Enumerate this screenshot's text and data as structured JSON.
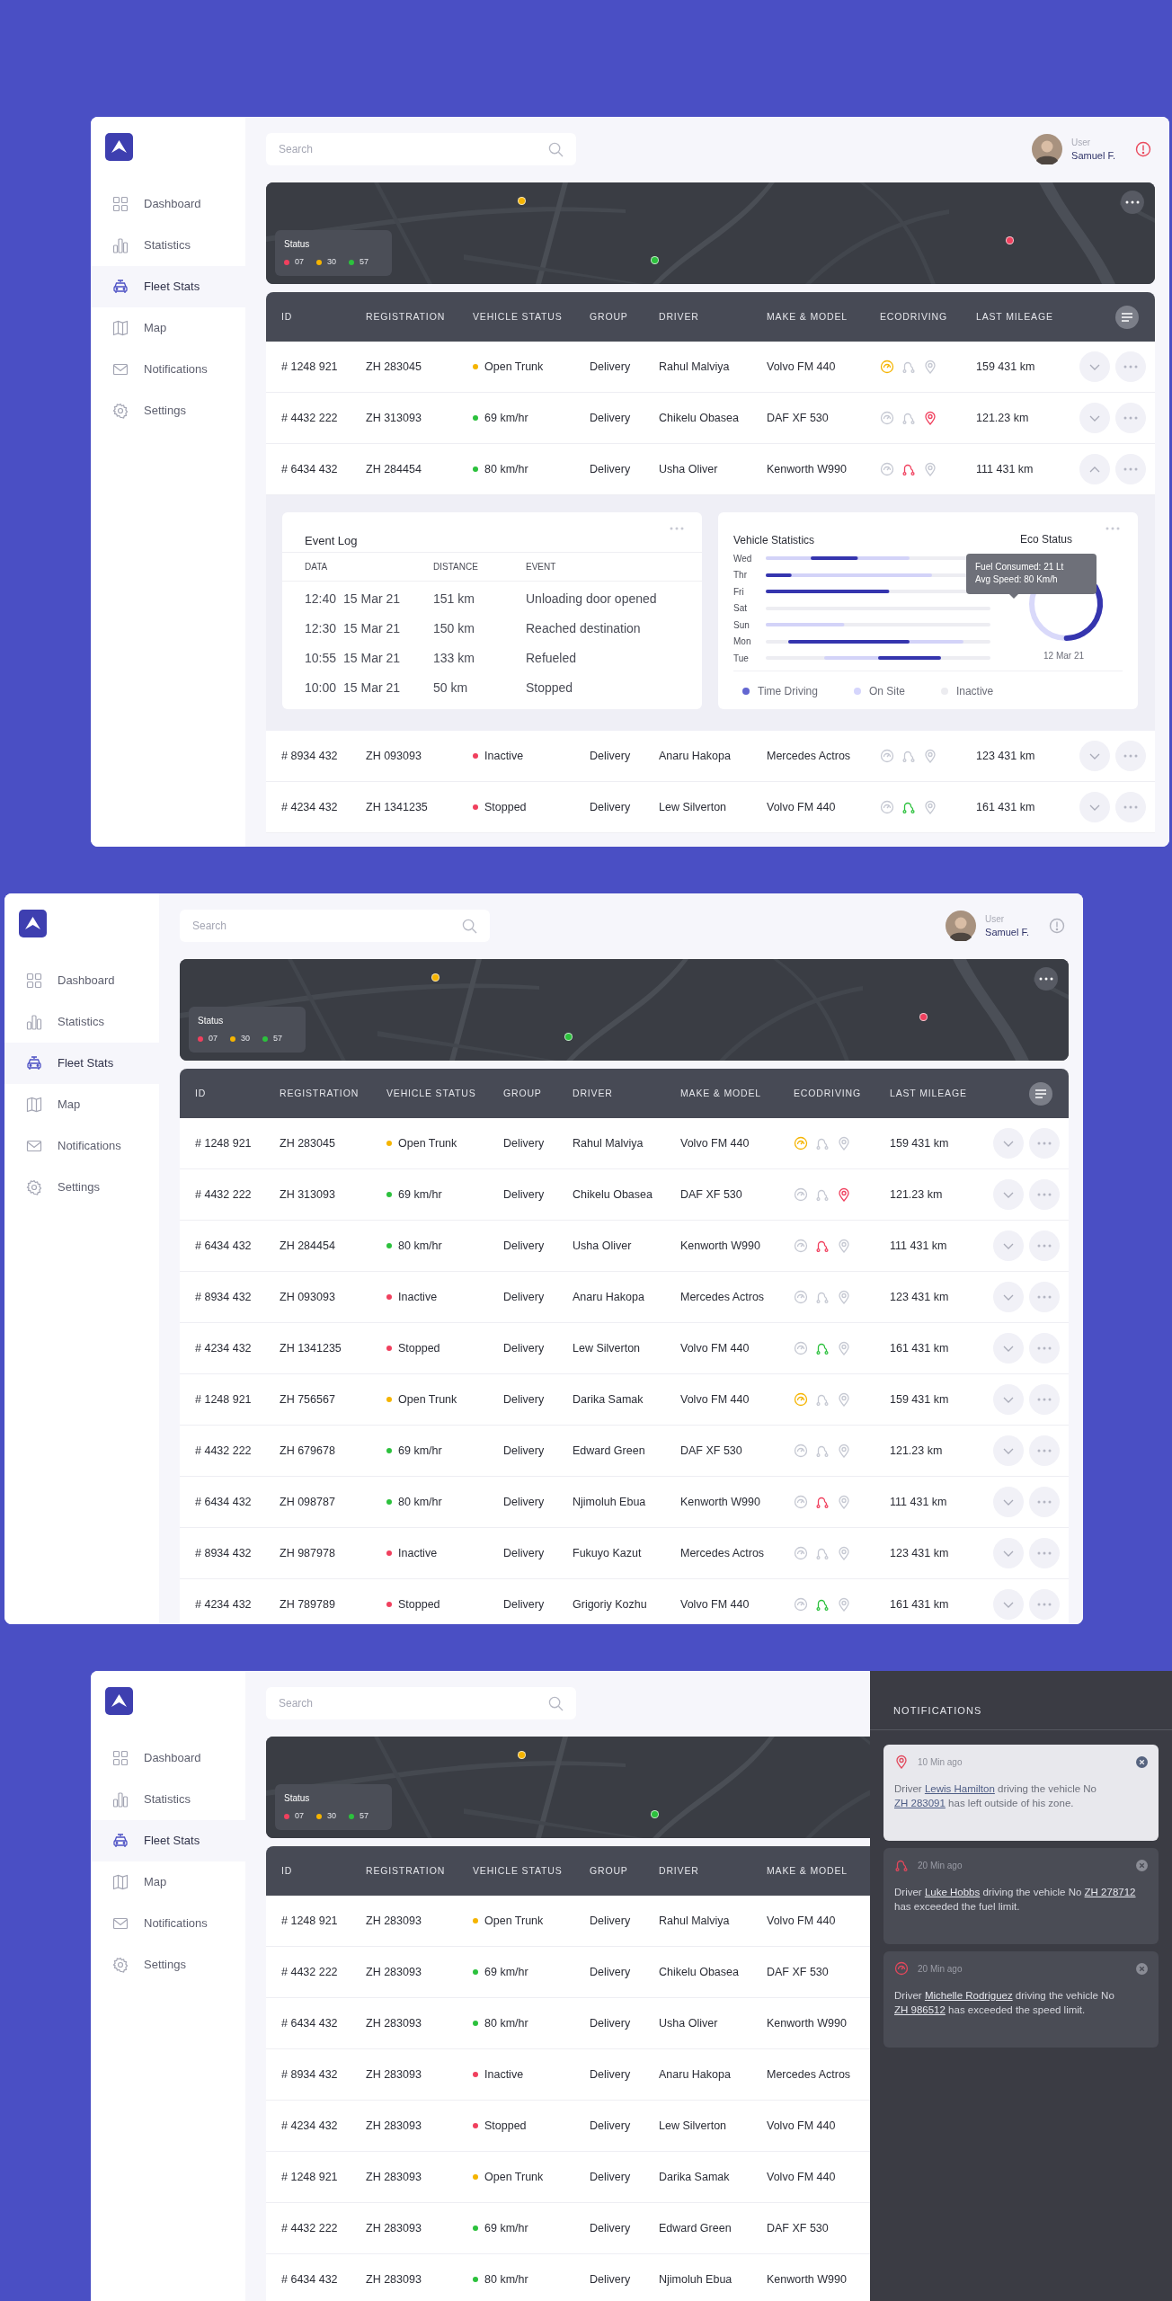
{
  "screens": [
    {
      "sidebar": {
        "items": [
          {
            "label": "Dashboard",
            "selected": false
          },
          {
            "label": "Statistics",
            "selected": false
          },
          {
            "label": "Fleet Stats",
            "selected": true
          },
          {
            "label": "Map",
            "selected": false
          },
          {
            "label": "Notifications",
            "selected": false
          },
          {
            "label": "Settings",
            "selected": false
          }
        ]
      },
      "header": {
        "search": {
          "placeholder": "Search"
        },
        "user": {
          "label": "User",
          "name": "Samuel F."
        },
        "alert": true
      },
      "map": {
        "pins": [
          {
            "color": "#f5b400"
          },
          {
            "color": "#2cc13d"
          },
          {
            "color": "#f0405e"
          }
        ],
        "status": {
          "title": "Status",
          "items": [
            {
              "count": "07",
              "color": "#f0405e"
            },
            {
              "count": "30",
              "color": "#f5b400"
            },
            {
              "count": "57",
              "color": "#2cc13d"
            }
          ]
        },
        "more_button": true
      },
      "table": {
        "columns": [
          "ID",
          "REGISTRATION",
          "VEHICLE STATUS",
          "GROUP",
          "DRIVER",
          "MAKE & MODEL",
          "ECODRIVING",
          "LAST MILEAGE"
        ],
        "filter_button": true,
        "rows": [
          {
            "id": "# 1248 921",
            "registration": "ZH 283045",
            "status": {
              "text": "Open Trunk",
              "color": "#f5b400"
            },
            "group": "Delivery",
            "driver": "Rahul Malviya",
            "model": "Volvo FM 440",
            "ecodriving": [
              {
                "color": "#f5b400"
              },
              {
                "color": "#c5c8d2"
              },
              {
                "color": "#c5c8d2"
              }
            ],
            "mileage": "159 431 km",
            "expanded": false
          },
          {
            "id": "# 4432 222",
            "registration": "ZH 313093",
            "status": {
              "text": "69 km/hr",
              "color": "#2cc13d"
            },
            "group": "Delivery",
            "driver": "Chikelu Obasea",
            "model": "DAF XF 530",
            "ecodriving": [
              {
                "color": "#c5c8d2"
              },
              {
                "color": "#c5c8d2"
              },
              {
                "color": "#f0405e"
              }
            ],
            "mileage": "121.23 km",
            "expanded": false
          },
          {
            "id": "# 6434 432",
            "registration": "ZH 284454",
            "status": {
              "text": "80 km/hr",
              "color": "#2cc13d"
            },
            "group": "Delivery",
            "driver": "Usha Oliver",
            "model": "Kenworth W990",
            "ecodriving": [
              {
                "color": "#c5c8d2"
              },
              {
                "color": "#f0405e"
              },
              {
                "color": "#c5c8d2"
              }
            ],
            "mileage": "111 431 km",
            "expanded": true,
            "details": {
              "event_log": {
                "title": "Event Log",
                "columns": [
                  "DATA",
                  "DISTANCE",
                  "EVENT"
                ],
                "rows": [
                  {
                    "time": "12:40",
                    "date": "15 Mar 21",
                    "distance": "151 km",
                    "event": "Unloading door opened"
                  },
                  {
                    "time": "12:30",
                    "date": "15 Mar 21",
                    "distance": "150 km",
                    "event": "Reached destination"
                  },
                  {
                    "time": "10:55",
                    "date": "15 Mar 21",
                    "distance": "133 km",
                    "event": "Refueled"
                  },
                  {
                    "time": "10:00",
                    "date": "15 Mar 21",
                    "distance": "50 km",
                    "event": "Stopped"
                  }
                ]
              },
              "vehicle_statistics": {
                "title": "Vehicle Statistics",
                "days": [
                  "Wed",
                  "Thr",
                  "Fri",
                  "Sat",
                  "Sun",
                  "Mon",
                  "Tue"
                ],
                "legend": [
                  {
                    "label": "Time Driving",
                    "color": "#6366d1"
                  },
                  {
                    "label": "On Site",
                    "color": "#d5d5fc"
                  },
                  {
                    "label": "Inactive",
                    "color": "#ececf0"
                  }
                ]
              },
              "eco_status": {
                "title": "Eco Status",
                "level": 0.33,
                "tooltip": [
                  "Fuel Consumed: 21 Lt",
                  "Avg Speed: 80 Km/h"
                ],
                "date": "12 Mar 21"
              }
            }
          },
          {
            "id": "# 8934 432",
            "registration": "ZH 093093",
            "status": {
              "text": "Inactive",
              "color": "#f0405e"
            },
            "group": "Delivery",
            "driver": "Anaru Hakopa",
            "model": "Mercedes Actros",
            "ecodriving": [
              {
                "color": "#c5c8d2"
              },
              {
                "color": "#c5c8d2"
              },
              {
                "color": "#c5c8d2"
              }
            ],
            "mileage": "123 431 km",
            "expanded": false
          },
          {
            "id": "# 4234 432",
            "registration": "ZH 1341235",
            "status": {
              "text": "Stopped",
              "color": "#f0405e"
            },
            "group": "Delivery",
            "driver": "Lew Silverton",
            "model": "Volvo FM 440",
            "ecodriving": [
              {
                "color": "#c5c8d2"
              },
              {
                "color": "#2cc13d"
              },
              {
                "color": "#c5c8d2"
              }
            ],
            "mileage": "161 431 km",
            "expanded": false
          }
        ]
      }
    },
    {
      "sidebar": {
        "items": [
          {
            "label": "Dashboard",
            "selected": false
          },
          {
            "label": "Statistics",
            "selected": false
          },
          {
            "label": "Fleet Stats",
            "selected": true
          },
          {
            "label": "Map",
            "selected": false
          },
          {
            "label": "Notifications",
            "selected": false
          },
          {
            "label": "Settings",
            "selected": false
          }
        ]
      },
      "header": {
        "search": {
          "placeholder": "Search"
        },
        "user": {
          "label": "User",
          "name": "Samuel F."
        },
        "alert": false
      },
      "map": {
        "pins": [
          {
            "color": "#f5b400"
          },
          {
            "color": "#2cc13d"
          },
          {
            "color": "#f0405e"
          }
        ],
        "status": {
          "title": "Status",
          "items": [
            {
              "count": "07",
              "color": "#f0405e"
            },
            {
              "count": "30",
              "color": "#f5b400"
            },
            {
              "count": "57",
              "color": "#2cc13d"
            }
          ]
        },
        "more_button": true
      },
      "table": {
        "columns": [
          "ID",
          "REGISTRATION",
          "VEHICLE STATUS",
          "GROUP",
          "DRIVER",
          "MAKE & MODEL",
          "ECODRIVING",
          "LAST MILEAGE"
        ],
        "filter_button": true,
        "rows": [
          {
            "id": "# 1248 921",
            "registration": "ZH 283045",
            "status": {
              "text": "Open Trunk",
              "color": "#f5b400"
            },
            "group": "Delivery",
            "driver": "Rahul Malviya",
            "model": "Volvo FM 440",
            "ecodriving": [
              {
                "color": "#f5b400"
              },
              {
                "color": "#c5c8d2"
              },
              {
                "color": "#c5c8d2"
              }
            ],
            "mileage": "159 431 km",
            "expanded": false
          },
          {
            "id": "# 4432 222",
            "registration": "ZH 313093",
            "status": {
              "text": "69 km/hr",
              "color": "#2cc13d"
            },
            "group": "Delivery",
            "driver": "Chikelu Obasea",
            "model": "DAF XF 530",
            "ecodriving": [
              {
                "color": "#c5c8d2"
              },
              {
                "color": "#c5c8d2"
              },
              {
                "color": "#f0405e"
              }
            ],
            "mileage": "121.23 km",
            "expanded": false
          },
          {
            "id": "# 6434 432",
            "registration": "ZH 284454",
            "status": {
              "text": "80 km/hr",
              "color": "#2cc13d"
            },
            "group": "Delivery",
            "driver": "Usha Oliver",
            "model": "Kenworth W990",
            "ecodriving": [
              {
                "color": "#c5c8d2"
              },
              {
                "color": "#f0405e"
              },
              {
                "color": "#c5c8d2"
              }
            ],
            "mileage": "111 431 km",
            "expanded": false
          },
          {
            "id": "# 8934 432",
            "registration": "ZH 093093",
            "status": {
              "text": "Inactive",
              "color": "#f0405e"
            },
            "group": "Delivery",
            "driver": "Anaru Hakopa",
            "model": "Mercedes Actros",
            "ecodriving": [
              {
                "color": "#c5c8d2"
              },
              {
                "color": "#c5c8d2"
              },
              {
                "color": "#c5c8d2"
              }
            ],
            "mileage": "123 431 km",
            "expanded": false
          },
          {
            "id": "# 4234 432",
            "registration": "ZH 1341235",
            "status": {
              "text": "Stopped",
              "color": "#f0405e"
            },
            "group": "Delivery",
            "driver": "Lew Silverton",
            "model": "Volvo FM 440",
            "ecodriving": [
              {
                "color": "#c5c8d2"
              },
              {
                "color": "#2cc13d"
              },
              {
                "color": "#c5c8d2"
              }
            ],
            "mileage": "161 431 km",
            "expanded": false
          },
          {
            "id": "# 1248 921",
            "registration": "ZH 756567",
            "status": {
              "text": "Open Trunk",
              "color": "#f5b400"
            },
            "group": "Delivery",
            "driver": "Darika Samak",
            "model": "Volvo FM 440",
            "ecodriving": [
              {
                "color": "#f5b400"
              },
              {
                "color": "#c5c8d2"
              },
              {
                "color": "#c5c8d2"
              }
            ],
            "mileage": "159 431 km",
            "expanded": false
          },
          {
            "id": "# 4432 222",
            "registration": "ZH 679678",
            "status": {
              "text": "69 km/hr",
              "color": "#2cc13d"
            },
            "group": "Delivery",
            "driver": "Edward Green",
            "model": "DAF XF 530",
            "ecodriving": [
              {
                "color": "#c5c8d2"
              },
              {
                "color": "#c5c8d2"
              },
              {
                "color": "#c5c8d2"
              }
            ],
            "mileage": "121.23 km",
            "expanded": false
          },
          {
            "id": "# 6434 432",
            "registration": "ZH 098787",
            "status": {
              "text": "80 km/hr",
              "color": "#2cc13d"
            },
            "group": "Delivery",
            "driver": "Njimoluh Ebua",
            "model": "Kenworth W990",
            "ecodriving": [
              {
                "color": "#c5c8d2"
              },
              {
                "color": "#f0405e"
              },
              {
                "color": "#c5c8d2"
              }
            ],
            "mileage": "111 431 km",
            "expanded": false
          },
          {
            "id": "# 8934 432",
            "registration": "ZH 987978",
            "status": {
              "text": "Inactive",
              "color": "#f0405e"
            },
            "group": "Delivery",
            "driver": "Fukuyo Kazut",
            "model": "Mercedes Actros",
            "ecodriving": [
              {
                "color": "#c5c8d2"
              },
              {
                "color": "#c5c8d2"
              },
              {
                "color": "#c5c8d2"
              }
            ],
            "mileage": "123 431 km",
            "expanded": false
          },
          {
            "id": "# 4234 432",
            "registration": "ZH 789789",
            "status": {
              "text": "Stopped",
              "color": "#f0405e"
            },
            "group": "Delivery",
            "driver": "Grigoriy Kozhu",
            "model": "Volvo FM 440",
            "ecodriving": [
              {
                "color": "#c5c8d2"
              },
              {
                "color": "#2cc13d"
              },
              {
                "color": "#c5c8d2"
              }
            ],
            "mileage": "161 431 km",
            "expanded": false
          }
        ]
      }
    },
    {
      "sidebar": {
        "items": [
          {
            "label": "Dashboard",
            "selected": false
          },
          {
            "label": "Statistics",
            "selected": false
          },
          {
            "label": "Fleet Stats",
            "selected": true
          },
          {
            "label": "Map",
            "selected": false
          },
          {
            "label": "Notifications",
            "selected": false
          },
          {
            "label": "Settings",
            "selected": false
          }
        ]
      },
      "header": {
        "search": {
          "placeholder": "Search"
        }
      },
      "map": {
        "pins": [
          {
            "color": "#f5b400"
          },
          {
            "color": "#2cc13d"
          }
        ],
        "status": {
          "title": "Status",
          "items": [
            {
              "count": "07",
              "color": "#f0405e"
            },
            {
              "count": "30",
              "color": "#f5b400"
            },
            {
              "count": "57",
              "color": "#2cc13d"
            }
          ]
        },
        "more_button": false
      },
      "table": {
        "columns": [
          "ID",
          "REGISTRATION",
          "VEHICLE STATUS",
          "GROUP",
          "DRIVER",
          "MAKE & MODEL"
        ],
        "filter_button": false,
        "rows": [
          {
            "id": "# 1248 921",
            "registration": "ZH 283093",
            "status": {
              "text": "Open Trunk",
              "color": "#f5b400"
            },
            "group": "Delivery",
            "driver": "Rahul Malviya",
            "model": "Volvo FM 440"
          },
          {
            "id": "# 4432 222",
            "registration": "ZH 283093",
            "status": {
              "text": "69 km/hr",
              "color": "#2cc13d"
            },
            "group": "Delivery",
            "driver": "Chikelu Obasea",
            "model": "DAF XF 530"
          },
          {
            "id": "# 6434 432",
            "registration": "ZH 283093",
            "status": {
              "text": "80 km/hr",
              "color": "#2cc13d"
            },
            "group": "Delivery",
            "driver": "Usha Oliver",
            "model": "Kenworth W990"
          },
          {
            "id": "# 8934 432",
            "registration": "ZH 283093",
            "status": {
              "text": "Inactive",
              "color": "#f0405e"
            },
            "group": "Delivery",
            "driver": "Anaru Hakopa",
            "model": "Mercedes Actros"
          },
          {
            "id": "# 4234 432",
            "registration": "ZH 283093",
            "status": {
              "text": "Stopped",
              "color": "#f0405e"
            },
            "group": "Delivery",
            "driver": "Lew Silverton",
            "model": "Volvo FM 440"
          },
          {
            "id": "# 1248 921",
            "registration": "ZH 283093",
            "status": {
              "text": "Open Trunk",
              "color": "#f5b400"
            },
            "group": "Delivery",
            "driver": "Darika Samak",
            "model": "Volvo FM 440"
          },
          {
            "id": "# 4432 222",
            "registration": "ZH 283093",
            "status": {
              "text": "69 km/hr",
              "color": "#2cc13d"
            },
            "group": "Delivery",
            "driver": "Edward Green",
            "model": "DAF XF 530"
          },
          {
            "id": "# 6434 432",
            "registration": "ZH 283093",
            "status": {
              "text": "80 km/hr",
              "color": "#2cc13d"
            },
            "group": "Delivery",
            "driver": "Njimoluh Ebua",
            "model": "Kenworth W990"
          }
        ]
      },
      "notifications": {
        "title": "NOTIFICATIONS",
        "items": [
          {
            "kind": "pin",
            "time": "10 Min ago",
            "highlighted": true,
            "parts": [
              {
                "text": "Driver ",
                "link": false
              },
              {
                "text": "Lewis Hamilton",
                "link": true
              },
              {
                "text": " driving the vehicle No ",
                "link": false
              },
              {
                "text": "ZH 283091",
                "link": true
              },
              {
                "text": " has left outside of his zone.",
                "link": false
              }
            ]
          },
          {
            "kind": "route",
            "time": "20 Min ago",
            "highlighted": false,
            "parts": [
              {
                "text": "Driver ",
                "link": false
              },
              {
                "text": "Luke Hobbs",
                "link": true
              },
              {
                "text": " driving the vehicle No ",
                "link": false
              },
              {
                "text": "ZH 278712",
                "link": true
              },
              {
                "text": " has exceeded the fuel limit.",
                "link": false
              }
            ]
          },
          {
            "kind": "gauge",
            "time": "20 Min ago",
            "highlighted": false,
            "parts": [
              {
                "text": "Driver ",
                "link": false
              },
              {
                "text": "Michelle Rodriguez",
                "link": true
              },
              {
                "text": " driving the vehicle No ",
                "link": false
              },
              {
                "text": "ZH 986512",
                "link": true
              },
              {
                "text": " has exceeded the speed limit.",
                "link": false
              }
            ]
          }
        ]
      }
    }
  ]
}
